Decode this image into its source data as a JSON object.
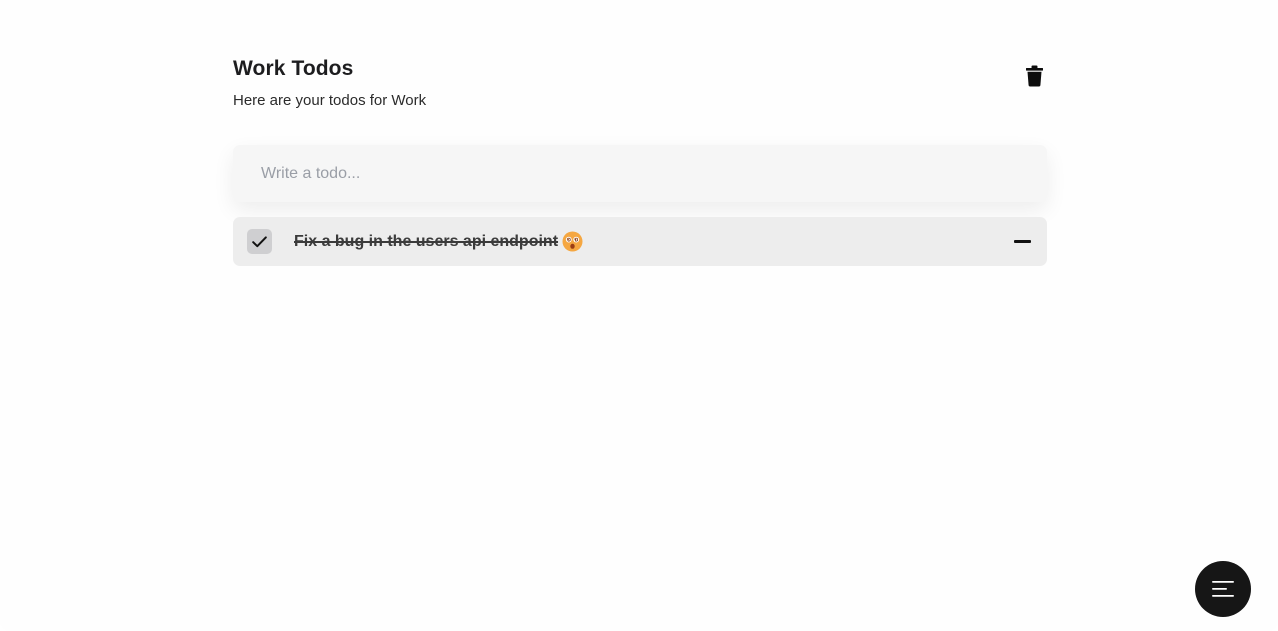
{
  "header": {
    "title": "Work Todos",
    "subtitle": "Here are your todos for Work",
    "delete_icon": "trash-icon"
  },
  "input": {
    "placeholder": "Write a todo...",
    "value": ""
  },
  "todos": [
    {
      "text": "Fix a bug in the users api endpoint",
      "completed": true,
      "emoji": "face-with-spiral-eyes",
      "remove_icon": "minus-icon"
    }
  ],
  "menu_button": {
    "icon": "menu-lines-icon"
  },
  "colors": {
    "background": "#fefefe",
    "input_bg": "#f6f6f6",
    "todo_bg": "#ededed",
    "checkbox_bg": "#cfcfd1",
    "fab_bg": "#161616",
    "emoji": "#f5a742"
  }
}
